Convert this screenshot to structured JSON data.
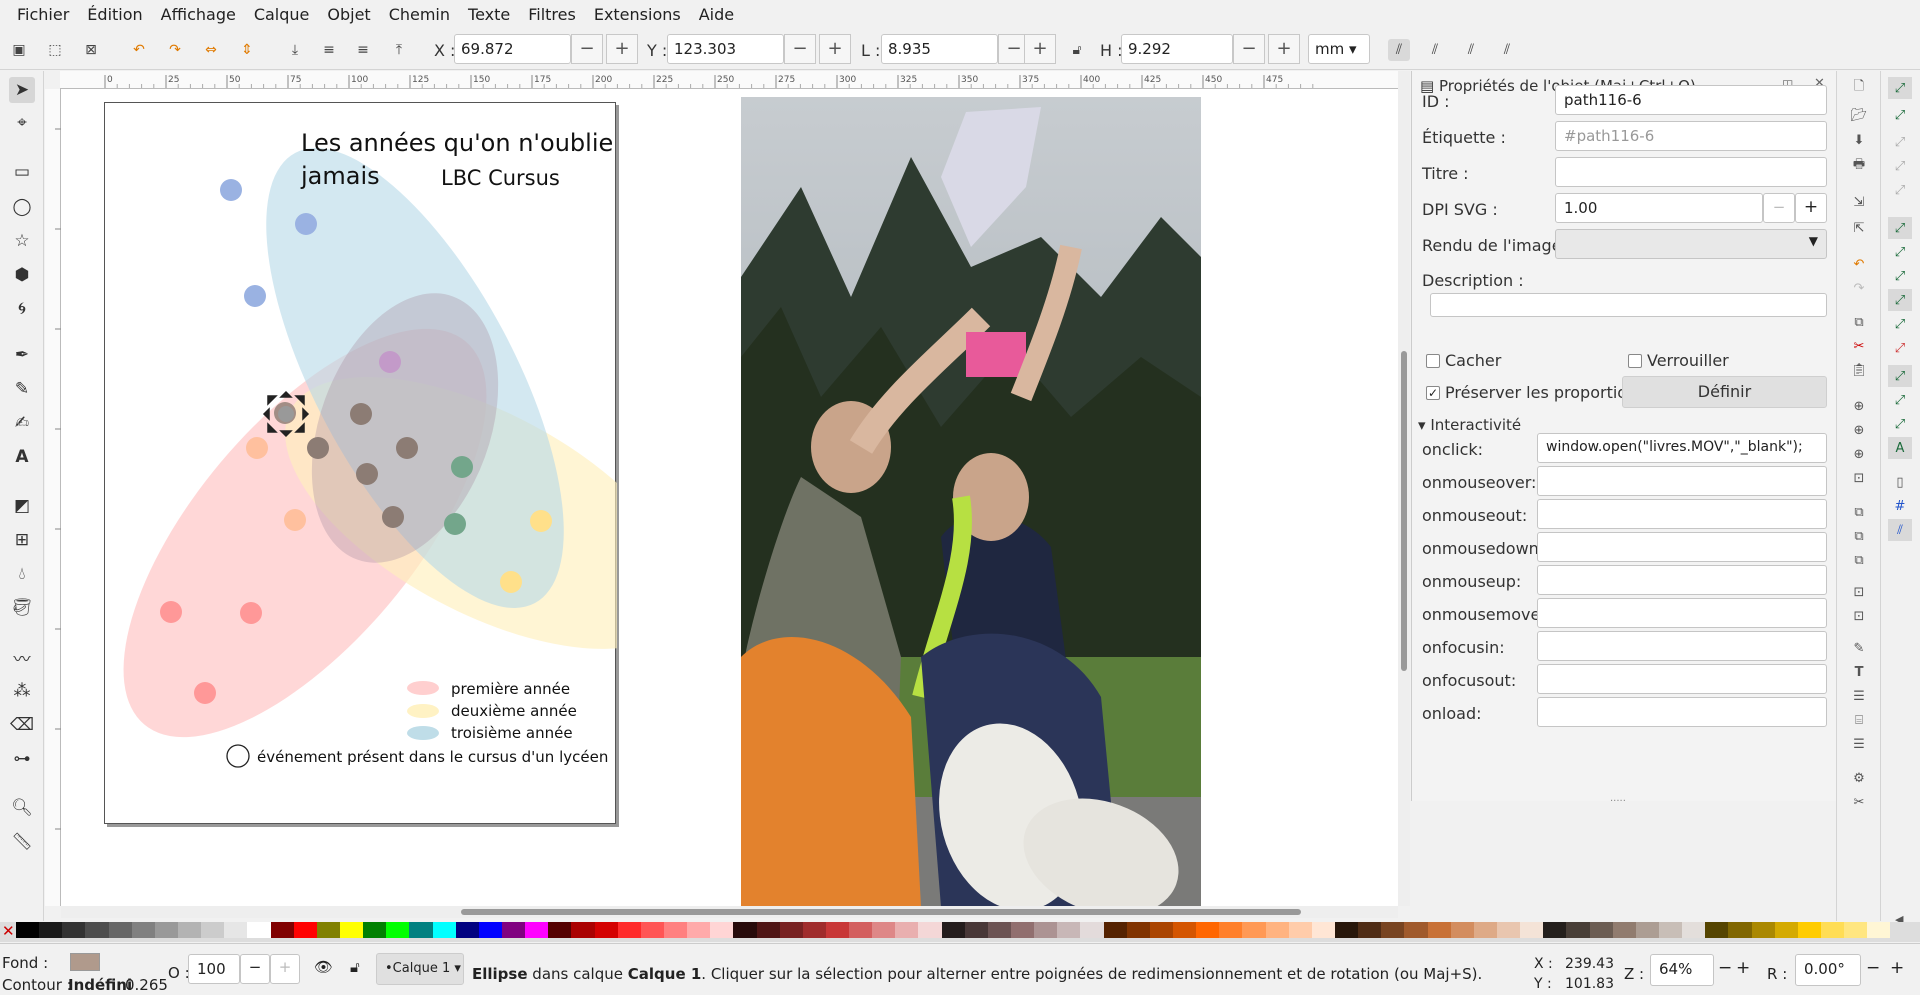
{
  "menu": [
    "Fichier",
    "Édition",
    "Affichage",
    "Calque",
    "Objet",
    "Chemin",
    "Texte",
    "Filtres",
    "Extensions",
    "Aide"
  ],
  "controls": {
    "x_label": "X :",
    "x_value": "69.872",
    "y_label": "Y :",
    "y_value": "123.303",
    "w_label": "L :",
    "w_value": "8.935",
    "h_label": "H :",
    "h_value": "9.292",
    "unit": "mm",
    "minus": "−",
    "plus": "+"
  },
  "ruler": {
    "h_ticks": [
      "0",
      "25",
      "50",
      "75",
      "100",
      "125",
      "150",
      "175",
      "200",
      "225",
      "250",
      "275",
      "300",
      "325",
      "350",
      "375",
      "400",
      "425",
      "450",
      "475"
    ]
  },
  "document": {
    "title_line1": "Les années qu'on n'oublie",
    "title_line2": "jamais",
    "subtitle": "LBC Cursus",
    "legend": [
      {
        "label": "première année",
        "color": "#ffcfcf"
      },
      {
        "label": "deuxième année",
        "color": "#fff2c4"
      },
      {
        "label": "troisième année",
        "color": "#bfdde8"
      }
    ],
    "legend_event": "événement présent dans le cursus d'un lycéen"
  },
  "panel": {
    "title": "Propriétés de l'objet (Maj+Ctrl+O)",
    "id_label": "ID :",
    "id_value": "path116-6",
    "label_label": "Étiquette :",
    "label_placeholder": "#path116-6",
    "title_label": "Titre :",
    "title_value": "",
    "dpi_label": "DPI SVG :",
    "dpi_value": "1.00",
    "render_label": "Rendu de l'image :",
    "desc_label": "Description :",
    "hide_label": "Cacher",
    "lock_label": "Verrouiller",
    "preserve_label": "Préserver les proportions",
    "preserve_checked": true,
    "define_button": "Définir",
    "interactivity_label": "Interactivité",
    "events": [
      {
        "name": "onclick:",
        "value": "window.open(\"livres.MOV\",\"_blank\");"
      },
      {
        "name": "onmouseover:",
        "value": ""
      },
      {
        "name": "onmouseout:",
        "value": ""
      },
      {
        "name": "onmousedown:",
        "value": ""
      },
      {
        "name": "onmouseup:",
        "value": ""
      },
      {
        "name": "onmousemove:",
        "value": ""
      },
      {
        "name": "onfocusin:",
        "value": ""
      },
      {
        "name": "onfocusout:",
        "value": ""
      },
      {
        "name": "onload:",
        "value": ""
      }
    ]
  },
  "status": {
    "fill_label": "Fond :",
    "fill_color": "#b09a8c",
    "stroke_label": "Contour :",
    "stroke_value": "Indéfini",
    "stroke_width": "0.265",
    "opacity_label": "O :",
    "opacity_value": "100",
    "layer": "•Calque 1",
    "message_type": "Ellipse",
    "message_in": "dans calque",
    "message_layer": "Calque 1",
    "message_rest": ". Cliquer sur la sélection pour alterner entre poignées de redimensionnement et de rotation (ou Maj+S).",
    "cursor_x_label": "X :",
    "cursor_x": "239.43",
    "cursor_y_label": "Y :",
    "cursor_y": "101.83",
    "zoom_label": "Z :",
    "zoom": "64%",
    "rotate_label": "R :",
    "rotate": "0.00°"
  },
  "palette": [
    "#000000",
    "#1a1a1a",
    "#333333",
    "#4d4d4d",
    "#666666",
    "#808080",
    "#999999",
    "#b3b3b3",
    "#cccccc",
    "#e6e6e6",
    "#ffffff",
    "#800000",
    "#ff0000",
    "#808000",
    "#ffff00",
    "#008000",
    "#00ff00",
    "#008080",
    "#00ffff",
    "#000080",
    "#0000ff",
    "#800080",
    "#ff00ff",
    "#550000",
    "#aa0000",
    "#d40000",
    "#ff2a2a",
    "#ff5555",
    "#ff8080",
    "#ffaaaa",
    "#ffd5d5",
    "#280b0b",
    "#501616",
    "#782121",
    "#a02c2c",
    "#c83737",
    "#d35f5f",
    "#de8787",
    "#e9afaf",
    "#f4d7d7",
    "#241c1c",
    "#483737",
    "#6c5353",
    "#916f6f",
    "#ac9393",
    "#c8b7b7",
    "#e3dbdb",
    "#552200",
    "#803300",
    "#aa4400",
    "#d45500",
    "#ff6600",
    "#ff7f2a",
    "#ff9955",
    "#ffb380",
    "#ffccaa",
    "#ffe6d5",
    "#28170b",
    "#502d16",
    "#784421",
    "#a05a2c",
    "#c87137",
    "#d38d5f",
    "#deaa87",
    "#e9c6af",
    "#f4e3d7",
    "#241f1c",
    "#483e37",
    "#6c5d53",
    "#917c6f",
    "#ac9d93",
    "#c8beb7",
    "#e3dedb",
    "#554400",
    "#806600",
    "#aa8800",
    "#d4aa00",
    "#ffcc00",
    "#ffdd55",
    "#ffe680",
    "#fff6d5"
  ]
}
